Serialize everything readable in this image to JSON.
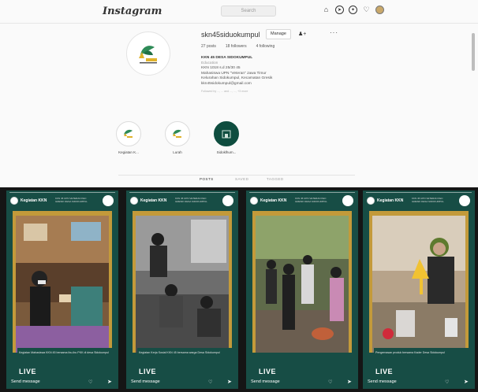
{
  "nav": {
    "logo": "Instagram",
    "search_placeholder": "Search",
    "icons": [
      "home-icon",
      "direct-icon",
      "explore-icon",
      "activity-icon",
      "profile-avatar"
    ]
  },
  "profile": {
    "username": "skn45siduokumpul",
    "manage_label": "Manage",
    "stats": {
      "posts": "27 posts",
      "followers": "18 followers",
      "following": "4 following"
    },
    "bio": {
      "name": "KKN 45 DESA SIDOKUMPUL",
      "category": "Education",
      "line1": "KKN 1018 s.d 25/30 45",
      "line2": "Mahasiswa UPN \"Veteran\" Jawa Timur",
      "line3": "Kelurahan Sidokumpul, Kecamatan Gresik",
      "line4": "kkn45sidokumpul@gmail.com",
      "followed_by": "Followed by ..., ... and ..., ..., +3 more"
    },
    "highlights": [
      {
        "label": "Kegiatan K..."
      },
      {
        "label": "Lurah"
      },
      {
        "label": "Sidoklhum..."
      }
    ],
    "tabs": {
      "posts": "POSTS",
      "saved": "SAVED",
      "tagged": "TAGGED"
    }
  },
  "stories": [
    {
      "title": "Kegiatan KKN",
      "sub": "KKN 45 UPN VETERAN KEC GRESIK DESA SIDOKUMPUL",
      "caption": "Kegiatan Mahasiswa KKN 45 bersama ibu-ibu PKK di desa Sidokumpul",
      "live": "LIVE",
      "reply": "Send message"
    },
    {
      "title": "Kegiatan KKN",
      "sub": "KKN 45 UPN VETERAN KEC GRESIK DESA SIDOKUMPUL",
      "caption": "Kegiatan Kerja Sosial KKN 45 bersama warga Desa Sidokumpul",
      "live": "LIVE",
      "reply": "Send message"
    },
    {
      "title": "Kegiatan KKN",
      "sub": "KKN 45 UPN VETERAN KEC GRESIK DESA SIDOKUMPUL",
      "caption": "",
      "live": "LIVE",
      "reply": "Send message"
    },
    {
      "title": "Kegiatan KKN",
      "sub": "KKN 45 UPN VETERAN KEC GRESIK DESA SIDOKUMPUL",
      "caption": "Pengemasan produk bersama Kader Desa Sidokumpul",
      "live": "LIVE",
      "reply": "Send message"
    }
  ],
  "colors": {
    "story_green": "#174d45",
    "story_gold": "#c39a3a",
    "highlight_dark": "#0e4d3f"
  }
}
